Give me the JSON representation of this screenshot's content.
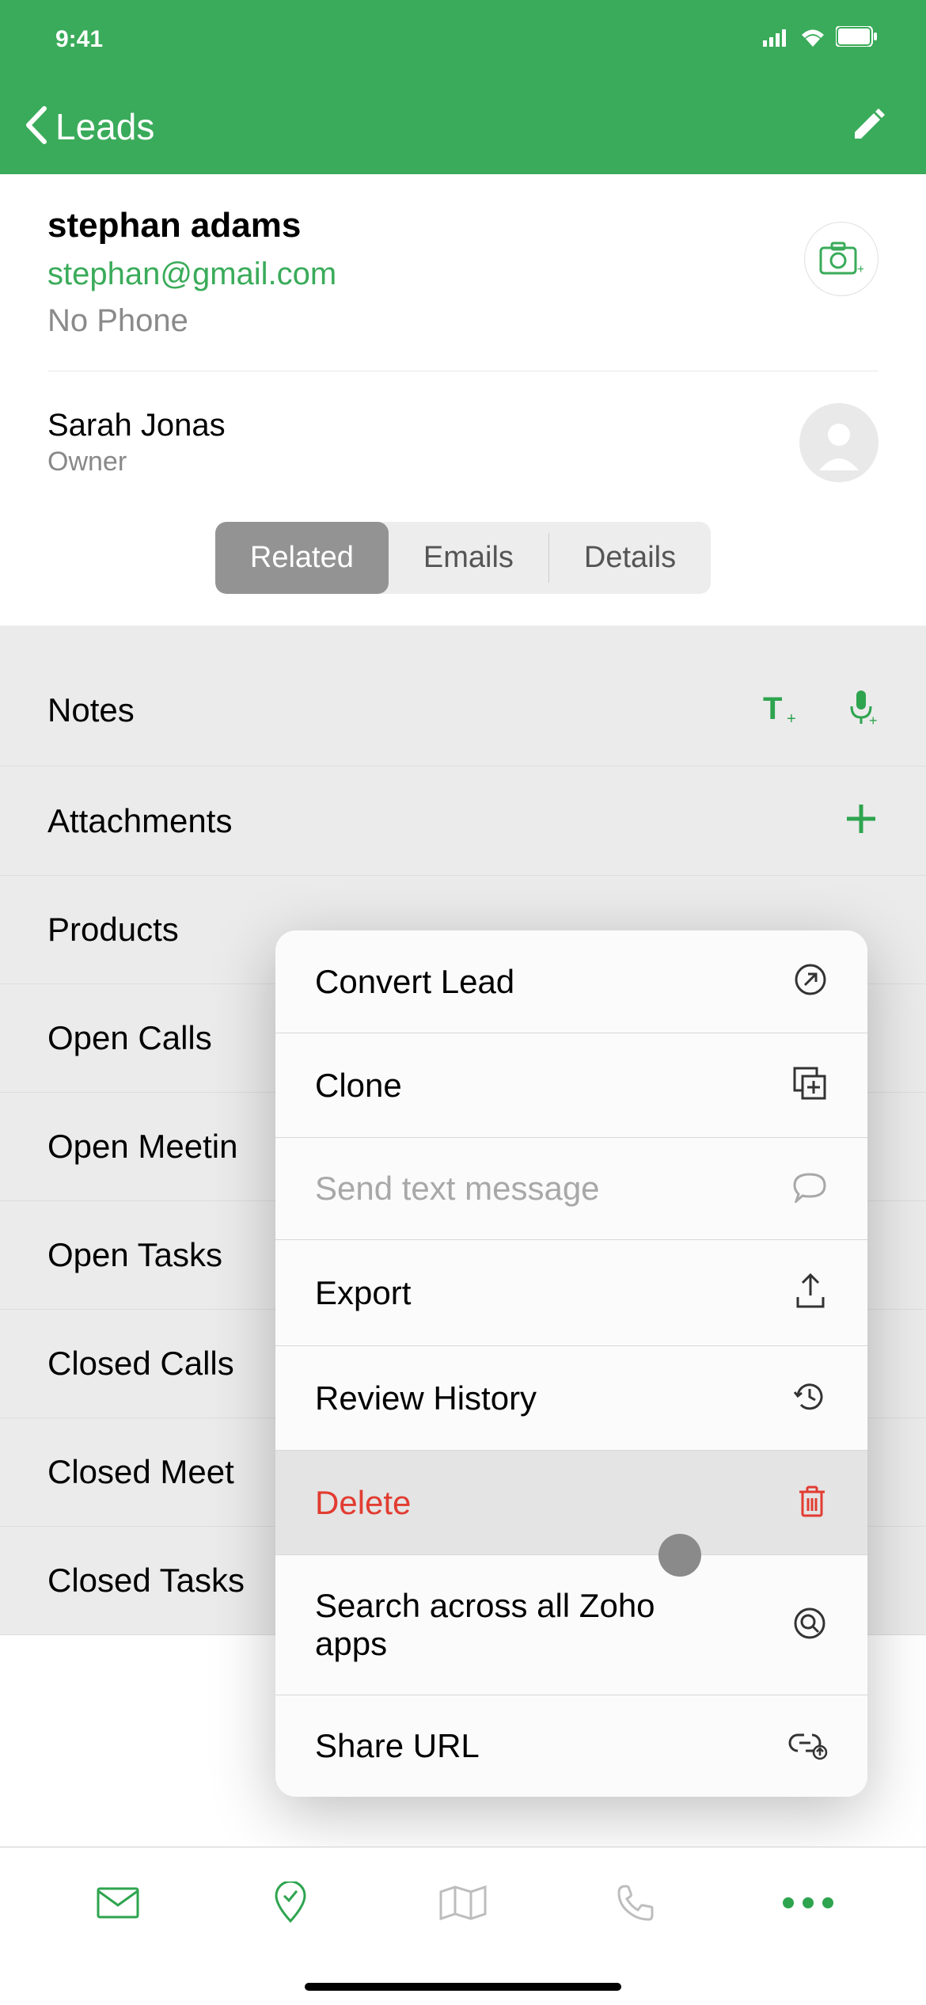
{
  "status": {
    "time": "9:41"
  },
  "nav": {
    "back_label": "Leads"
  },
  "lead": {
    "name": "stephan adams",
    "email": "stephan@gmail.com",
    "phone": "No Phone"
  },
  "owner": {
    "name": "Sarah Jonas",
    "role": "Owner"
  },
  "tabs": {
    "related": "Related",
    "emails": "Emails",
    "details": "Details"
  },
  "related": {
    "notes": "Notes",
    "attachments": "Attachments",
    "products": "Products",
    "open_calls": "Open Calls",
    "open_meetings": "Open Meetin",
    "open_tasks": "Open Tasks",
    "closed_calls": "Closed Calls",
    "closed_meetings": "Closed Meet",
    "closed_tasks": "Closed Tasks"
  },
  "menu": {
    "convert": "Convert Lead",
    "clone": "Clone",
    "sms": "Send text message",
    "export": "Export",
    "review": "Review History",
    "delete": "Delete",
    "search_all": "Search across all Zoho apps",
    "share_url": "Share URL"
  },
  "colors": {
    "primary": "#3AAB5A",
    "danger": "#e23c31"
  }
}
